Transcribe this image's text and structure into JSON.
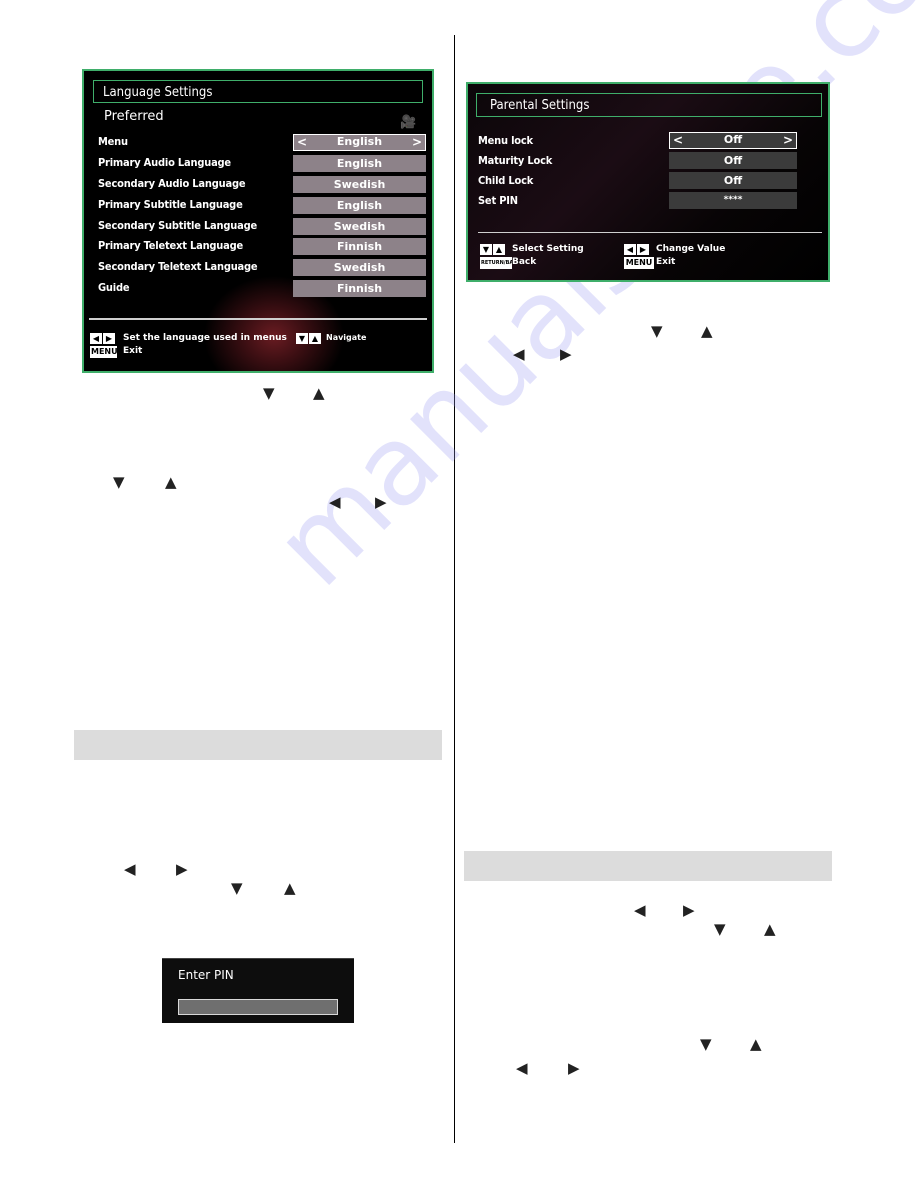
{
  "language_settings": {
    "title": "Language Settings",
    "subtitle": "Preferred",
    "rows": [
      {
        "label": "Menu",
        "value": "English",
        "selected": true
      },
      {
        "label": "Primary Audio Language",
        "value": "English"
      },
      {
        "label": "Secondary Audio Language",
        "value": "Swedish"
      },
      {
        "label": "Primary Subtitle Language",
        "value": "English"
      },
      {
        "label": "Secondary Subtitle Language",
        "value": "Swedish"
      },
      {
        "label": "Primary Teletext Language",
        "value": "Finnish"
      },
      {
        "label": "Secondary Teletext Language",
        "value": "Swedish"
      },
      {
        "label": "Guide",
        "value": "Finnish"
      }
    ],
    "legend": {
      "set_language": "Set the language used in menus",
      "navigate": "Navigate",
      "menu_key": "MENU",
      "exit": "Exit"
    },
    "chevron_left": "<",
    "chevron_right": ">"
  },
  "parental_settings": {
    "title": "Parental Settings",
    "rows": [
      {
        "label": "Menu lock",
        "value": "Off",
        "selected": true
      },
      {
        "label": "Maturity Lock",
        "value": "Off"
      },
      {
        "label": "Child Lock",
        "value": "Off"
      },
      {
        "label": "Set PIN",
        "value": "****"
      }
    ],
    "legend": {
      "select_setting": "Select Setting",
      "change_value": "Change Value",
      "return_key": "RETURN/BACK",
      "back": "Back",
      "menu_key": "MENU",
      "exit": "Exit"
    }
  },
  "enter_pin": {
    "title": "Enter PIN",
    "value": ""
  },
  "glyphs": {
    "down": "▼",
    "up": "▲",
    "left": "◀",
    "right": "▶"
  },
  "watermark": "manualshive.com"
}
